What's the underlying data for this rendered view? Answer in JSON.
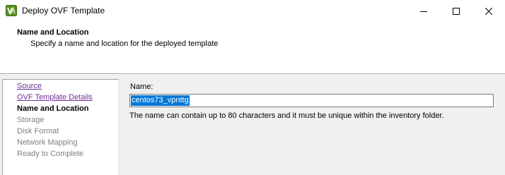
{
  "window": {
    "title": "Deploy OVF Template",
    "icon": "vsphere-app-icon",
    "controls": {
      "minimize": "minimize-icon",
      "maximize": "maximize-icon",
      "close": "close-icon"
    }
  },
  "header": {
    "title": "Name and Location",
    "subtitle": "Specify a name and location for the deployed template"
  },
  "steps": [
    {
      "label": "Source",
      "state": "link"
    },
    {
      "label": "OVF Template Details",
      "state": "link"
    },
    {
      "label": "Name and Location",
      "state": "current"
    },
    {
      "label": "Storage",
      "state": "disabled"
    },
    {
      "label": "Disk Format",
      "state": "disabled"
    },
    {
      "label": "Network Mapping",
      "state": "disabled"
    },
    {
      "label": "Ready to Complete",
      "state": "disabled"
    }
  ],
  "form": {
    "name_label": "Name:",
    "name_value": "centos73_vpnttg",
    "hint": "The name can contain up to 80 characters and it must be unique within the inventory folder."
  },
  "colors": {
    "link": "#6f3198",
    "selection": "#0078d7",
    "panel_bg": "#f0f0f0",
    "disabled_text": "#808080"
  }
}
